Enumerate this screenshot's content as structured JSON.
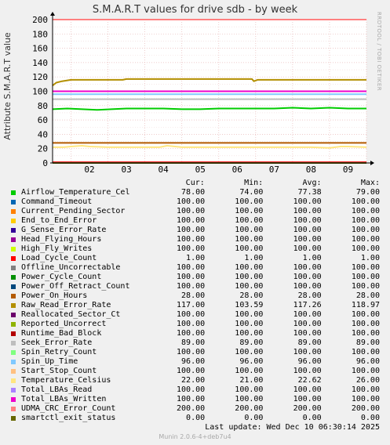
{
  "title": "S.M.A.R.T values for drive sdb - by week",
  "ylabel": "Attribute S.M.A.R.T value",
  "watermark": "RRDTOOL / TOBI OETIKER",
  "legend_headers": {
    "cur": "Cur:",
    "min": "Min:",
    "avg": "Avg:",
    "max": "Max:"
  },
  "legend": [
    {
      "name": "Airflow_Temperature_Cel",
      "color": "#00cc00",
      "cur": "78.00",
      "min": "74.00",
      "avg": "77.38",
      "max": "79.00"
    },
    {
      "name": "Command_Timeout",
      "color": "#0066b3",
      "cur": "100.00",
      "min": "100.00",
      "avg": "100.00",
      "max": "100.00"
    },
    {
      "name": "Current_Pending_Sector",
      "color": "#ff8000",
      "cur": "100.00",
      "min": "100.00",
      "avg": "100.00",
      "max": "100.00"
    },
    {
      "name": "End_to_End_Error",
      "color": "#ffcc00",
      "cur": "100.00",
      "min": "100.00",
      "avg": "100.00",
      "max": "100.00"
    },
    {
      "name": "G_Sense_Error_Rate",
      "color": "#330099",
      "cur": "100.00",
      "min": "100.00",
      "avg": "100.00",
      "max": "100.00"
    },
    {
      "name": "Head_Flying_Hours",
      "color": "#990099",
      "cur": "100.00",
      "min": "100.00",
      "avg": "100.00",
      "max": "100.00"
    },
    {
      "name": "High_Fly_Writes",
      "color": "#ccff00",
      "cur": "100.00",
      "min": "100.00",
      "avg": "100.00",
      "max": "100.00"
    },
    {
      "name": "Load_Cycle_Count",
      "color": "#ff0000",
      "cur": "1.00",
      "min": "1.00",
      "avg": "1.00",
      "max": "1.00"
    },
    {
      "name": "Offline_Uncorrectable",
      "color": "#808080",
      "cur": "100.00",
      "min": "100.00",
      "avg": "100.00",
      "max": "100.00"
    },
    {
      "name": "Power_Cycle_Count",
      "color": "#008f00",
      "cur": "100.00",
      "min": "100.00",
      "avg": "100.00",
      "max": "100.00"
    },
    {
      "name": "Power_Off_Retract_Count",
      "color": "#00487d",
      "cur": "100.00",
      "min": "100.00",
      "avg": "100.00",
      "max": "100.00"
    },
    {
      "name": "Power_On_Hours",
      "color": "#b35a00",
      "cur": "28.00",
      "min": "28.00",
      "avg": "28.00",
      "max": "28.00"
    },
    {
      "name": "Raw_Read_Error_Rate",
      "color": "#b38f00",
      "cur": "117.00",
      "min": "103.59",
      "avg": "117.26",
      "max": "118.97"
    },
    {
      "name": "Reallocated_Sector_Ct",
      "color": "#6b006b",
      "cur": "100.00",
      "min": "100.00",
      "avg": "100.00",
      "max": "100.00"
    },
    {
      "name": "Reported_Uncorrect",
      "color": "#8fb300",
      "cur": "100.00",
      "min": "100.00",
      "avg": "100.00",
      "max": "100.00"
    },
    {
      "name": "Runtime_Bad_Block",
      "color": "#b30000",
      "cur": "100.00",
      "min": "100.00",
      "avg": "100.00",
      "max": "100.00"
    },
    {
      "name": "Seek_Error_Rate",
      "color": "#bebebe",
      "cur": "89.00",
      "min": "89.00",
      "avg": "89.00",
      "max": "89.00"
    },
    {
      "name": "Spin_Retry_Count",
      "color": "#80ff80",
      "cur": "100.00",
      "min": "100.00",
      "avg": "100.00",
      "max": "100.00"
    },
    {
      "name": "Spin_Up_Time",
      "color": "#80c9ff",
      "cur": "96.00",
      "min": "96.00",
      "avg": "96.00",
      "max": "96.00"
    },
    {
      "name": "Start_Stop_Count",
      "color": "#ffc080",
      "cur": "100.00",
      "min": "100.00",
      "avg": "100.00",
      "max": "100.00"
    },
    {
      "name": "Temperature_Celsius",
      "color": "#ffe680",
      "cur": "22.00",
      "min": "21.00",
      "avg": "22.62",
      "max": "26.00"
    },
    {
      "name": "Total_LBAs_Read",
      "color": "#aa80ff",
      "cur": "100.00",
      "min": "100.00",
      "avg": "100.00",
      "max": "100.00"
    },
    {
      "name": "Total_LBAs_Written",
      "color": "#ee00cc",
      "cur": "100.00",
      "min": "100.00",
      "avg": "100.00",
      "max": "100.00"
    },
    {
      "name": "UDMA_CRC_Error_Count",
      "color": "#ff8080",
      "cur": "200.00",
      "min": "200.00",
      "avg": "200.00",
      "max": "200.00"
    },
    {
      "name": "smartctl_exit_status",
      "color": "#666600",
      "cur": "0.00",
      "min": "0.00",
      "avg": "0.00",
      "max": "0.00"
    }
  ],
  "last_update": "Last update: Wed Dec 10 06:30:14 2025",
  "version": "Munin 2.0.6-4+deb7u4",
  "chart_data": {
    "type": "line",
    "title": "S.M.A.R.T values for drive sdb - by week",
    "ylabel": "Attribute S.M.A.R.T value",
    "xlabel": "",
    "categories": [
      "02",
      "03",
      "04",
      "05",
      "06",
      "07",
      "08",
      "09"
    ],
    "x_range": [
      0,
      8.5
    ],
    "ylim": [
      0,
      200
    ],
    "yticks": [
      0,
      20,
      40,
      60,
      80,
      100,
      120,
      140,
      160,
      180,
      200
    ],
    "grid": true,
    "legend_placement": "bottom",
    "series": [
      {
        "name": "Airflow_Temperature_Cel",
        "color": "#00cc00",
        "x": [
          0,
          0.4,
          0.8,
          1.2,
          1.6,
          2.0,
          2.5,
          3.0,
          3.5,
          4.0,
          4.5,
          5.0,
          5.5,
          6.0,
          6.5,
          7.0,
          7.5,
          8.0,
          8.5
        ],
        "y": [
          75,
          76,
          75,
          74,
          75,
          76,
          76,
          76,
          75,
          75,
          76,
          76,
          76,
          76,
          77,
          76,
          77,
          76,
          76
        ]
      },
      {
        "name": "Command_Timeout",
        "color": "#0066b3",
        "x": [
          0,
          8.5
        ],
        "y": [
          100,
          100
        ]
      },
      {
        "name": "Current_Pending_Sector",
        "color": "#ff8000",
        "x": [
          0,
          8.5
        ],
        "y": [
          100,
          100
        ]
      },
      {
        "name": "End_to_End_Error",
        "color": "#ffcc00",
        "x": [
          0,
          8.5
        ],
        "y": [
          100,
          100
        ]
      },
      {
        "name": "G_Sense_Error_Rate",
        "color": "#330099",
        "x": [
          0,
          8.5
        ],
        "y": [
          100,
          100
        ]
      },
      {
        "name": "Head_Flying_Hours",
        "color": "#990099",
        "x": [
          0,
          8.5
        ],
        "y": [
          100,
          100
        ]
      },
      {
        "name": "High_Fly_Writes",
        "color": "#ccff00",
        "x": [
          0,
          8.5
        ],
        "y": [
          100,
          100
        ]
      },
      {
        "name": "Load_Cycle_Count",
        "color": "#ff0000",
        "x": [
          0,
          8.5
        ],
        "y": [
          1,
          1
        ]
      },
      {
        "name": "Offline_Uncorrectable",
        "color": "#808080",
        "x": [
          0,
          8.5
        ],
        "y": [
          100,
          100
        ]
      },
      {
        "name": "Power_Cycle_Count",
        "color": "#008f00",
        "x": [
          0,
          8.5
        ],
        "y": [
          100,
          100
        ]
      },
      {
        "name": "Power_Off_Retract_Count",
        "color": "#00487d",
        "x": [
          0,
          8.5
        ],
        "y": [
          100,
          100
        ]
      },
      {
        "name": "Power_On_Hours",
        "color": "#b35a00",
        "x": [
          0,
          8.5
        ],
        "y": [
          28,
          28
        ]
      },
      {
        "name": "Raw_Read_Error_Rate",
        "color": "#b38f00",
        "x": [
          0,
          0.1,
          0.25,
          0.5,
          1.0,
          1.5,
          1.9,
          2.0,
          3.0,
          4.0,
          5.0,
          5.4,
          5.45,
          5.55,
          6.0,
          7.0,
          8.0,
          8.5
        ],
        "y": [
          108,
          112,
          114,
          116,
          116,
          116,
          116,
          117,
          117,
          117,
          117,
          117,
          114,
          116,
          116,
          116,
          116,
          116
        ]
      },
      {
        "name": "Reallocated_Sector_Ct",
        "color": "#6b006b",
        "x": [
          0,
          8.5
        ],
        "y": [
          100,
          100
        ]
      },
      {
        "name": "Reported_Uncorrect",
        "color": "#8fb300",
        "x": [
          0,
          8.5
        ],
        "y": [
          100,
          100
        ]
      },
      {
        "name": "Runtime_Bad_Block",
        "color": "#b30000",
        "x": [
          0,
          8.5
        ],
        "y": [
          100,
          100
        ]
      },
      {
        "name": "Seek_Error_Rate",
        "color": "#bebebe",
        "x": [
          0,
          8.5
        ],
        "y": [
          89,
          89
        ]
      },
      {
        "name": "Spin_Retry_Count",
        "color": "#80ff80",
        "x": [
          0,
          8.5
        ],
        "y": [
          100,
          100
        ]
      },
      {
        "name": "Spin_Up_Time",
        "color": "#80c9ff",
        "x": [
          0,
          8.5
        ],
        "y": [
          96,
          96
        ]
      },
      {
        "name": "Start_Stop_Count",
        "color": "#ffc080",
        "x": [
          0,
          8.5
        ],
        "y": [
          100,
          100
        ]
      },
      {
        "name": "Temperature_Celsius",
        "color": "#ffe680",
        "x": [
          0,
          0.3,
          0.5,
          0.8,
          1.0,
          1.5,
          2.0,
          2.5,
          2.9,
          3.1,
          3.5,
          4.0,
          4.5,
          5.0,
          5.5,
          6.0,
          6.5,
          7.0,
          7.5,
          7.8,
          8.0,
          8.5
        ],
        "y": [
          22,
          22,
          23,
          24,
          23,
          22,
          22,
          22,
          22,
          24,
          22,
          22,
          22,
          22,
          22,
          22,
          22,
          22,
          21,
          23,
          23,
          22
        ]
      },
      {
        "name": "Total_LBAs_Read",
        "color": "#aa80ff",
        "x": [
          0,
          8.5
        ],
        "y": [
          100,
          100
        ]
      },
      {
        "name": "Total_LBAs_Written",
        "color": "#ee00cc",
        "x": [
          0,
          8.5
        ],
        "y": [
          100,
          100
        ]
      },
      {
        "name": "UDMA_CRC_Error_Count",
        "color": "#ff8080",
        "x": [
          0,
          8.5
        ],
        "y": [
          200,
          200
        ]
      },
      {
        "name": "smartctl_exit_status",
        "color": "#666600",
        "x": [
          0,
          8.5
        ],
        "y": [
          0,
          0
        ]
      }
    ]
  }
}
